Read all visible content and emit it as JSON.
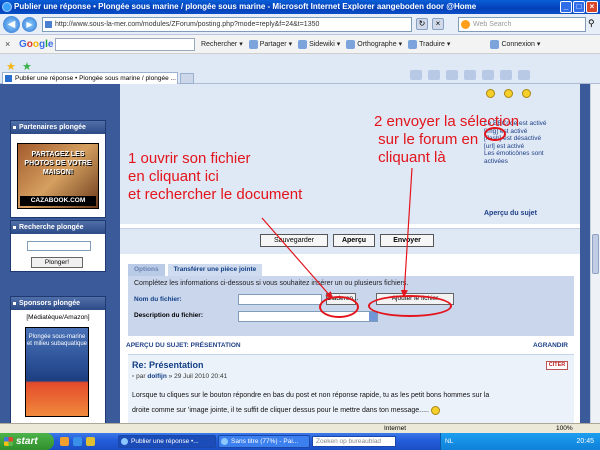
{
  "window": {
    "title": "Publier une réponse • Plongée sous marine / plongée sous marine - Microsoft Internet Explorer aangeboden door @Home"
  },
  "address": {
    "url": "http://www.sous-la-mer.com/modules/ZForum/posting.php?mode=reply&f=24&t=1350",
    "search_placeholder": "Web Search"
  },
  "google_toolbar": {
    "logo": "Google",
    "items": [
      "Rechercher",
      "Partager",
      "Sidewiki",
      "Orthographe",
      "Traduire",
      "Connexion"
    ]
  },
  "tab": {
    "label": "Publier une réponse • Plongée sous marine / plongée ..."
  },
  "sidebar": {
    "partners_title": "Partenaires plongée",
    "promo_text": "PARTAGEZ LES PHOTOS DE VOTRE MAISON!",
    "promo_site": "CAZABOOK.COM",
    "search_title": "Recherche plongée",
    "search_button": "Plonger!",
    "sponsors_title": "Sponsors plongée",
    "sponsors_sub": "[Médiatèque/Amazon]",
    "book_title": "Plongée sous-marine et milieu subaquatique"
  },
  "bbcode": {
    "lines": [
      "Le BBCode est activé",
      "[img] est activé",
      "[flash] est désactivé",
      "[url] est activé",
      "Les émoticônes sont",
      "activées"
    ],
    "apercu_sujet": "Aperçu du sujet"
  },
  "buttons": {
    "save": "Sauvegarder",
    "preview": "Aperçu",
    "send": "Envoyer"
  },
  "tabs": {
    "options": "Options",
    "attach": "Transférer une pièce jointe"
  },
  "attach": {
    "intro": "Complétez les informations ci-dessous si vous souhaitez insérer un ou plusieurs fichiers.",
    "file_label": "Nom du fichier:",
    "browse_button": "Bladeren...",
    "add_button": "Ajouter le fichier",
    "desc_label": "Description du fichier:"
  },
  "preview": {
    "header": "APERÇU DU SUJET: PRÉSENTATION",
    "expand": "AGRANDIR",
    "post_title": "Re: Présentation",
    "post_meta_prefix": "par",
    "post_author": "dolfijn",
    "post_date": "» 29 Juil 2010 20:41",
    "quote": "CITER",
    "body_line1": "Lorsque tu cliques sur le bouton répondre en bas du post et non réponse rapide, tu as les petit bons hommes sur la",
    "body_line2": "droite comme sur 'image jointe, il te suffit de cliquer dessus pour le mettre dans ton message....."
  },
  "annotations": {
    "step1": [
      "1 ouvrir son fichier",
      "en cliquant ici",
      "et rechercher le document"
    ],
    "step2": [
      "2 envoyer la sélection",
      " sur le forum en",
      " cliquant là"
    ]
  },
  "status": {
    "zone": "Internet",
    "zoom": "100%"
  },
  "taskbar": {
    "start": "start",
    "task1": "Publier une réponse •...",
    "task2": "Sans titre (77%) - Pai...",
    "desktop_search": "Zoeken op bureaublad",
    "lang": "NL",
    "clock": "20:45"
  },
  "colors": {
    "annotation": "#e3141b",
    "page_bg": "#3b5a9a",
    "panel": "#dfe8f5",
    "link": "#123f85"
  }
}
